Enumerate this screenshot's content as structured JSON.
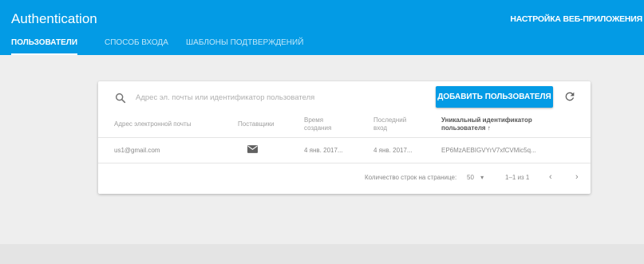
{
  "header": {
    "app_title": "Authentication",
    "settings_link": "НАСТРОЙКА ВЕБ-ПРИЛОЖЕНИЯ",
    "tabs": [
      {
        "label": "ПОЛЬЗОВАТЕЛИ",
        "active": true
      },
      {
        "label": "СПОСОБ ВХОДА",
        "active": false
      },
      {
        "label": "ШАБЛОНЫ ПОДТВЕРЖДЕНИЙ",
        "active": false
      }
    ]
  },
  "search": {
    "placeholder": "Адрес эл. почты или идентификатор пользователя",
    "icon": "search-icon"
  },
  "toolbar": {
    "add_user_label": "ДОБАВИТЬ ПОЛЬЗОВАТЕЛЯ",
    "refresh_icon": "refresh-icon"
  },
  "table": {
    "columns": [
      "Адрес электронной почты",
      "Поставщики",
      "Время создания",
      "Последний вход",
      "Уникальный идентификатор пользователя"
    ],
    "sort_indicator": "↑",
    "rows": [
      {
        "email": "us1@gmail.com",
        "provider_icon": "mail-icon",
        "created": "4 янв. 2017...",
        "last_login": "4 янв. 2017...",
        "uid": "EP6MzAEBIGVYrV7xfCVMic5q..."
      }
    ]
  },
  "pagination": {
    "rows_per_page_label": "Количество строк на странице:",
    "rows_per_page": "50",
    "range": "1–1 из 1"
  },
  "colors": {
    "accent": "#039be5",
    "background": "#eeeeee",
    "card": "#ffffff"
  }
}
